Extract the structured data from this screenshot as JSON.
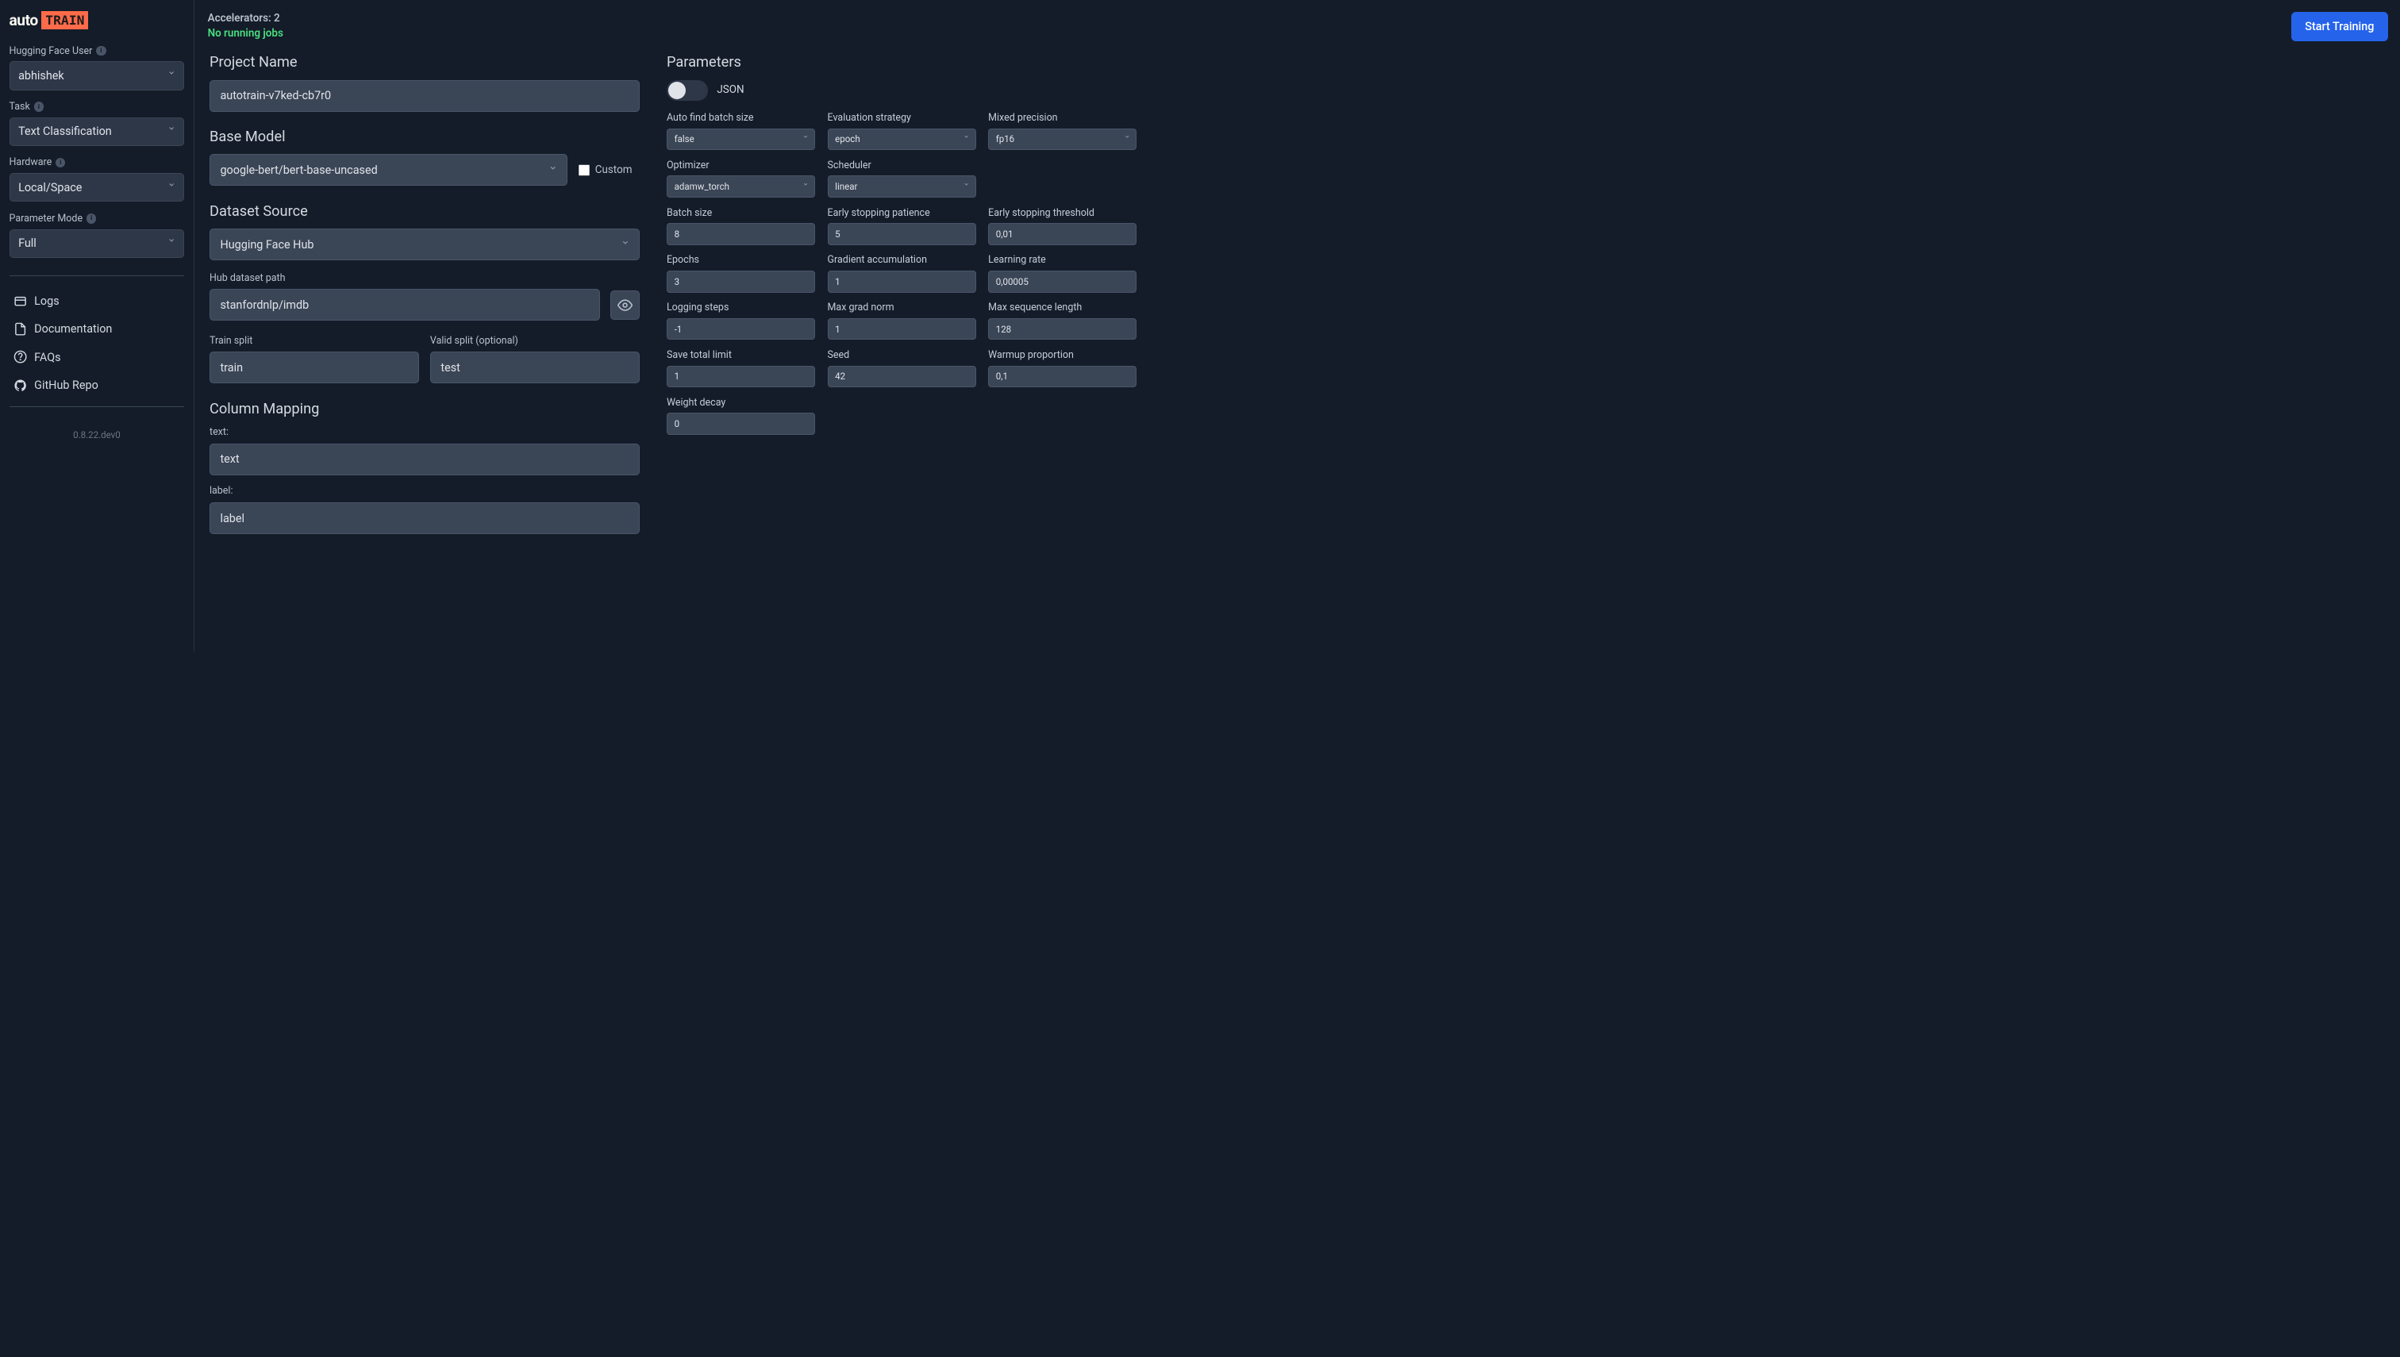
{
  "logo": {
    "auto": "auto",
    "train": "TRAIN"
  },
  "topbar": {
    "accelerators": "Accelerators: 2",
    "jobs": "No running jobs",
    "start_button": "Start Training"
  },
  "sidebar": {
    "user_label": "Hugging Face User",
    "user_value": "abhishek",
    "task_label": "Task",
    "task_value": "Text Classification",
    "hardware_label": "Hardware",
    "hardware_value": "Local/Space",
    "param_mode_label": "Parameter Mode",
    "param_mode_value": "Full",
    "nav": {
      "logs": "Logs",
      "docs": "Documentation",
      "faqs": "FAQs",
      "github": "GitHub Repo"
    },
    "version": "0.8.22.dev0"
  },
  "project": {
    "name_label": "Project Name",
    "name_value": "autotrain-v7ked-cb7r0",
    "base_model_label": "Base Model",
    "base_model_value": "google-bert/bert-base-uncased",
    "custom_label": "Custom",
    "dataset_source_label": "Dataset Source",
    "dataset_source_value": "Hugging Face Hub",
    "hub_path_label": "Hub dataset path",
    "hub_path_value": "stanfordnlp/imdb",
    "train_split_label": "Train split",
    "train_split_value": "train",
    "valid_split_label": "Valid split (optional)",
    "valid_split_value": "test",
    "column_mapping_label": "Column Mapping",
    "text_label": "text:",
    "text_value": "text",
    "label_label": "label:",
    "label_value": "label"
  },
  "parameters": {
    "title": "Parameters",
    "json_label": "JSON",
    "fields": {
      "auto_batch": {
        "label": "Auto find batch size",
        "value": "false"
      },
      "eval_strategy": {
        "label": "Evaluation strategy",
        "value": "epoch"
      },
      "mixed_precision": {
        "label": "Mixed precision",
        "value": "fp16"
      },
      "optimizer": {
        "label": "Optimizer",
        "value": "adamw_torch"
      },
      "scheduler": {
        "label": "Scheduler",
        "value": "linear"
      },
      "batch_size": {
        "label": "Batch size",
        "value": "8"
      },
      "early_stop_patience": {
        "label": "Early stopping patience",
        "value": "5"
      },
      "early_stop_threshold": {
        "label": "Early stopping threshold",
        "value": "0,01"
      },
      "epochs": {
        "label": "Epochs",
        "value": "3"
      },
      "grad_accum": {
        "label": "Gradient accumulation",
        "value": "1"
      },
      "learning_rate": {
        "label": "Learning rate",
        "value": "0,00005"
      },
      "logging_steps": {
        "label": "Logging steps",
        "value": "-1"
      },
      "max_grad_norm": {
        "label": "Max grad norm",
        "value": "1"
      },
      "max_seq_len": {
        "label": "Max sequence length",
        "value": "128"
      },
      "save_total_limit": {
        "label": "Save total limit",
        "value": "1"
      },
      "seed": {
        "label": "Seed",
        "value": "42"
      },
      "warmup": {
        "label": "Warmup proportion",
        "value": "0,1"
      },
      "weight_decay": {
        "label": "Weight decay",
        "value": "0"
      }
    }
  }
}
